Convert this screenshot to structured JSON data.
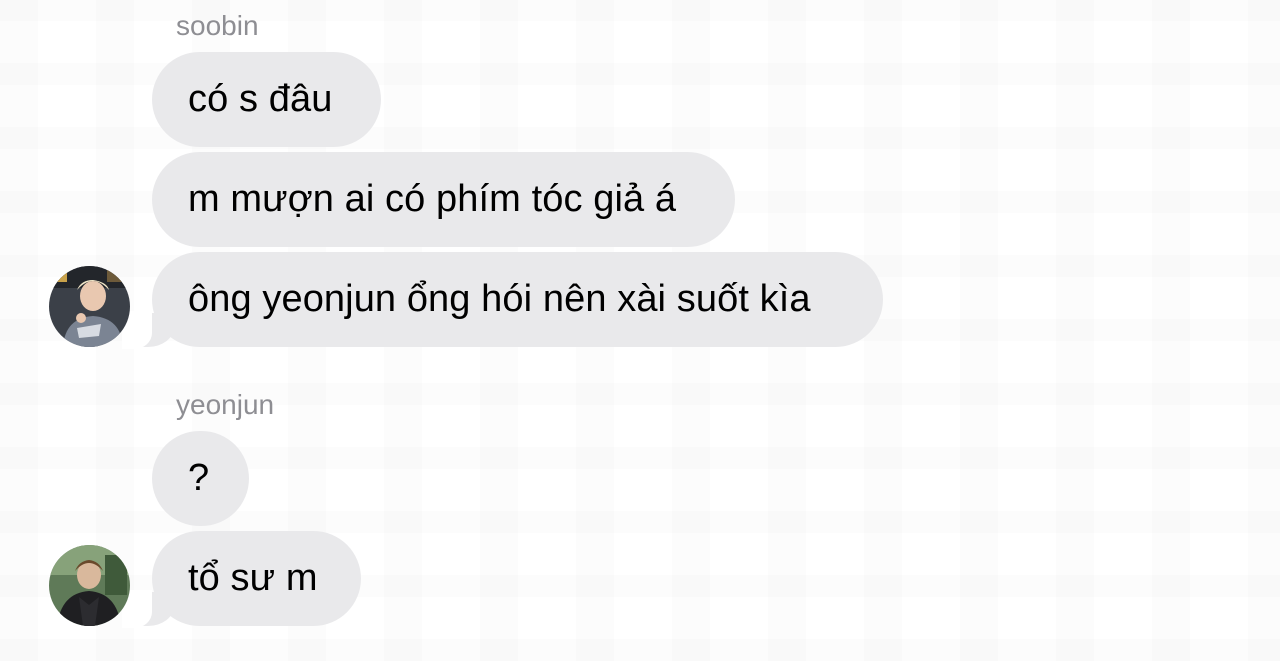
{
  "messages": [
    {
      "sender": "soobin",
      "bubbles": [
        "có s đâu",
        "m mượn ai có phím tóc giả á",
        "ông yeonjun ổng hói nên xài suốt kìa"
      ],
      "avatar_icon": "user-avatar-icon"
    },
    {
      "sender": "yeonjun",
      "bubbles": [
        "?",
        "tổ sư m"
      ],
      "avatar_icon": "user-avatar-icon"
    }
  ],
  "colors": {
    "bubble_bg": "#e9e9eb",
    "sender_name": "#8e8e93",
    "message_text": "#000000",
    "background": "#ffffff"
  }
}
